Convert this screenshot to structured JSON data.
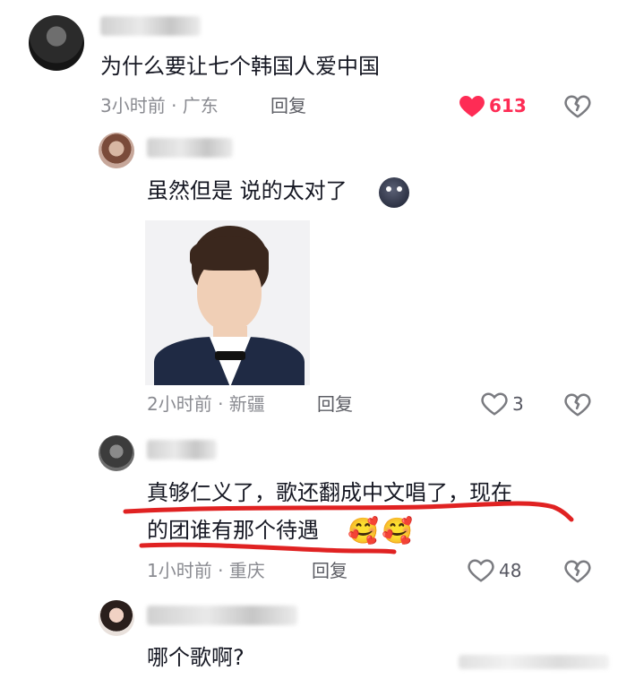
{
  "comments": [
    {
      "text": "为什么要让七个韩国人爱中国",
      "time_location": "3小时前 · 广东",
      "reply_label": "回复",
      "likes": "613",
      "liked": true,
      "like_color": "#fe2c55"
    },
    {
      "text": "虽然但是 说的太对了",
      "time_location": "2小时前 · 新疆",
      "reply_label": "回复",
      "likes": "3"
    },
    {
      "text_line1": "真够仁义了，歌还翻成中文唱了，现在",
      "text_line2": "的团谁有那个待遇",
      "time_location": "1小时前 · 重庆",
      "reply_label": "回复",
      "likes": "48",
      "annotation_color": "#e02222"
    },
    {
      "text": "哪个歌啊?"
    }
  ]
}
